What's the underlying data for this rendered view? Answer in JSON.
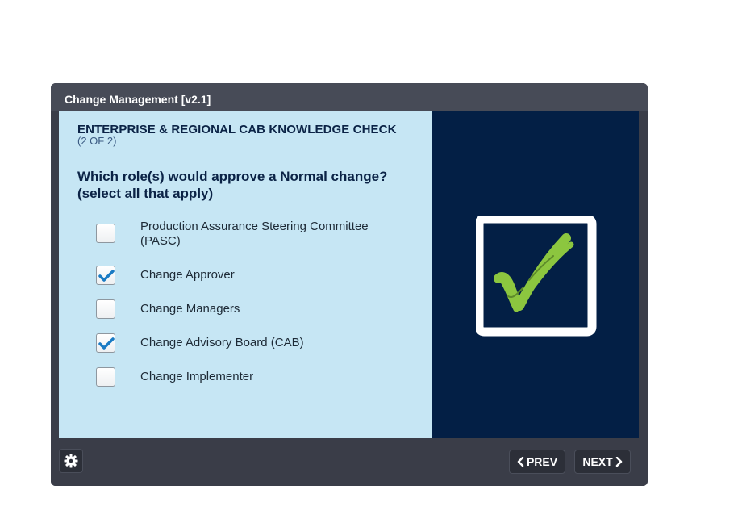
{
  "window": {
    "title": "Change Management [v2.1]"
  },
  "slide": {
    "heading": "ENTERPRISE & REGIONAL CAB KNOWLEDGE CHECK",
    "subheading": "(2 OF 2)",
    "question": "Which role(s) would approve a Normal change? (select all that apply)",
    "options": [
      {
        "label": "Production Assurance Steering Committee (PASC)",
        "checked": false
      },
      {
        "label": "Change Approver",
        "checked": true
      },
      {
        "label": "Change Managers",
        "checked": false
      },
      {
        "label": "Change Advisory Board (CAB)",
        "checked": true
      },
      {
        "label": "Change Implementer",
        "checked": false
      }
    ]
  },
  "footer": {
    "settings_icon": "gear-icon",
    "prev_label": "PREV",
    "next_label": "NEXT",
    "prev_icon": "chevron-left-icon",
    "next_icon": "chevron-right-icon"
  },
  "colors": {
    "frame": "#3a3d48",
    "slide_bg": "#c6e6f4",
    "panel_bg": "#031f45",
    "checkmark_blue": "#1a7bc4",
    "checkmark_green": "#8cc63f"
  }
}
